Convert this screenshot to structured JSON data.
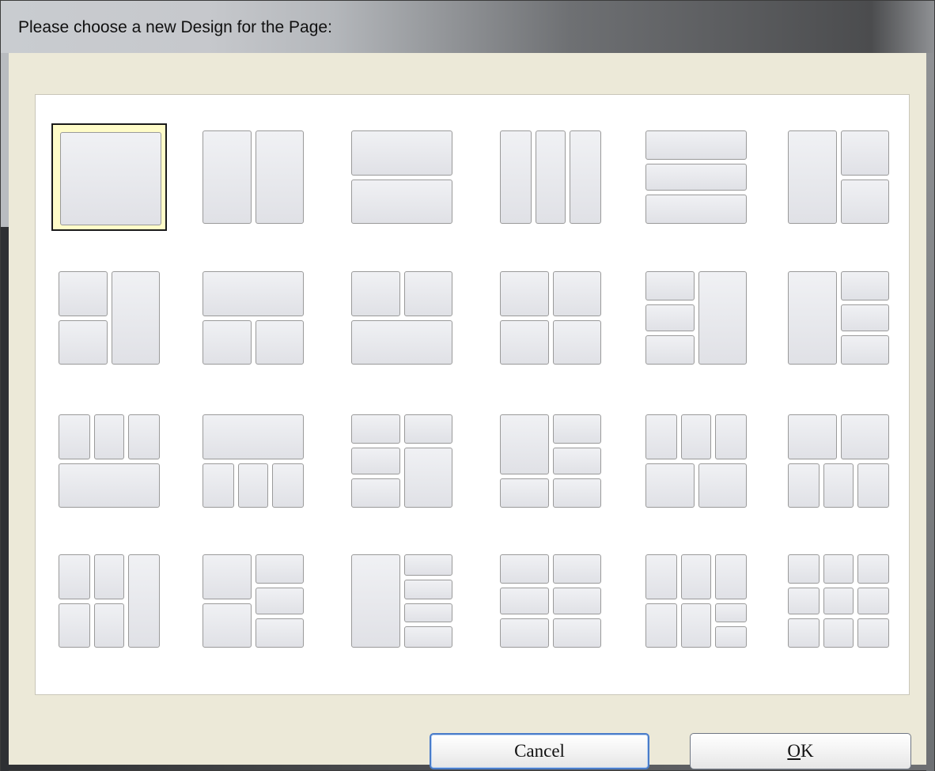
{
  "window": {
    "title": "Please choose a new Design for the Page:"
  },
  "buttons": {
    "cancel_label": "Cancel",
    "ok_mnemonic": "O",
    "ok_rest": "K"
  },
  "layouts": [
    {
      "name": "layout-1-single",
      "selected": true,
      "cells": [
        [
          0,
          0,
          1,
          1
        ]
      ]
    },
    {
      "name": "layout-2-columns",
      "cells": [
        [
          0,
          0,
          0.5,
          1
        ],
        [
          0.5,
          0,
          1,
          1
        ]
      ]
    },
    {
      "name": "layout-2-rows",
      "cells": [
        [
          0,
          0,
          1,
          0.5
        ],
        [
          0,
          0.5,
          1,
          1
        ]
      ]
    },
    {
      "name": "layout-3-columns",
      "cells": [
        [
          0,
          0,
          0.333,
          1
        ],
        [
          0.333,
          0,
          0.667,
          1
        ],
        [
          0.667,
          0,
          1,
          1
        ]
      ]
    },
    {
      "name": "layout-3-rows",
      "cells": [
        [
          0,
          0,
          1,
          0.333
        ],
        [
          0,
          0.333,
          1,
          0.667
        ],
        [
          0,
          0.667,
          1,
          1
        ]
      ]
    },
    {
      "name": "layout-big-left-two-right",
      "cells": [
        [
          0,
          0,
          0.5,
          1
        ],
        [
          0.5,
          0,
          1,
          0.5
        ],
        [
          0.5,
          0.5,
          1,
          1
        ]
      ]
    },
    {
      "name": "layout-two-left-big-right",
      "cells": [
        [
          0,
          0,
          0.5,
          0.5
        ],
        [
          0,
          0.5,
          0.5,
          1
        ],
        [
          0.5,
          0,
          1,
          1
        ]
      ]
    },
    {
      "name": "layout-top-wide-two-bottom",
      "cells": [
        [
          0,
          0,
          1,
          0.5
        ],
        [
          0,
          0.5,
          0.5,
          1
        ],
        [
          0.5,
          0.5,
          1,
          1
        ]
      ]
    },
    {
      "name": "layout-two-top-wide-bottom",
      "cells": [
        [
          0,
          0,
          0.5,
          0.5
        ],
        [
          0.5,
          0,
          1,
          0.5
        ],
        [
          0,
          0.5,
          1,
          1
        ]
      ]
    },
    {
      "name": "layout-2x2-grid",
      "cells": [
        [
          0,
          0,
          0.5,
          0.5
        ],
        [
          0.5,
          0,
          1,
          0.5
        ],
        [
          0,
          0.5,
          0.5,
          1
        ],
        [
          0.5,
          0.5,
          1,
          1
        ]
      ]
    },
    {
      "name": "layout-three-left-big-right",
      "cells": [
        [
          0,
          0,
          0.5,
          0.333
        ],
        [
          0,
          0.333,
          0.5,
          0.667
        ],
        [
          0,
          0.667,
          0.5,
          1
        ],
        [
          0.5,
          0,
          1,
          1
        ]
      ]
    },
    {
      "name": "layout-big-left-three-right",
      "cells": [
        [
          0,
          0,
          0.5,
          1
        ],
        [
          0.5,
          0,
          1,
          0.333
        ],
        [
          0.5,
          0.333,
          1,
          0.667
        ],
        [
          0.5,
          0.667,
          1,
          1
        ]
      ]
    },
    {
      "name": "layout-three-top-wide-bottom",
      "cells": [
        [
          0,
          0,
          0.333,
          0.5
        ],
        [
          0.333,
          0,
          0.667,
          0.5
        ],
        [
          0.667,
          0,
          1,
          0.5
        ],
        [
          0,
          0.5,
          1,
          1
        ]
      ]
    },
    {
      "name": "layout-wide-top-three-bottom",
      "cells": [
        [
          0,
          0,
          1,
          0.5
        ],
        [
          0,
          0.5,
          0.333,
          1
        ],
        [
          0.333,
          0.5,
          0.667,
          1
        ],
        [
          0.667,
          0.5,
          1,
          1
        ]
      ]
    },
    {
      "name": "layout-three-left-top-right-big",
      "cells": [
        [
          0,
          0,
          0.5,
          0.333
        ],
        [
          0.5,
          0,
          1,
          0.333
        ],
        [
          0,
          0.333,
          0.5,
          0.667
        ],
        [
          0,
          0.667,
          0.5,
          1
        ],
        [
          0.5,
          0.333,
          1,
          1
        ]
      ]
    },
    {
      "name": "layout-big-topleft-mixed",
      "cells": [
        [
          0,
          0,
          0.5,
          0.667
        ],
        [
          0.5,
          0,
          1,
          0.333
        ],
        [
          0.5,
          0.333,
          1,
          0.667
        ],
        [
          0,
          0.667,
          0.5,
          1
        ],
        [
          0.5,
          0.667,
          1,
          1
        ]
      ]
    },
    {
      "name": "layout-three-top-two-bottom",
      "cells": [
        [
          0,
          0,
          0.333,
          0.5
        ],
        [
          0.333,
          0,
          0.667,
          0.5
        ],
        [
          0.667,
          0,
          1,
          0.5
        ],
        [
          0,
          0.5,
          0.5,
          1
        ],
        [
          0.5,
          0.5,
          1,
          1
        ]
      ]
    },
    {
      "name": "layout-two-top-three-bottom",
      "cells": [
        [
          0,
          0,
          0.5,
          0.5
        ],
        [
          0.5,
          0,
          1,
          0.5
        ],
        [
          0,
          0.5,
          0.333,
          1
        ],
        [
          0.333,
          0.5,
          0.667,
          1
        ],
        [
          0.667,
          0.5,
          1,
          1
        ]
      ]
    },
    {
      "name": "layout-2x2-left-tall-right",
      "cells": [
        [
          0,
          0,
          0.333,
          0.5
        ],
        [
          0.333,
          0,
          0.667,
          0.5
        ],
        [
          0,
          0.5,
          0.333,
          1
        ],
        [
          0.333,
          0.5,
          0.667,
          1
        ],
        [
          0.667,
          0,
          1,
          1
        ]
      ]
    },
    {
      "name": "layout-two-left-three-right",
      "cells": [
        [
          0,
          0,
          0.5,
          0.5
        ],
        [
          0,
          0.5,
          0.5,
          1
        ],
        [
          0.5,
          0,
          1,
          0.333
        ],
        [
          0.5,
          0.333,
          1,
          0.667
        ],
        [
          0.5,
          0.667,
          1,
          1
        ]
      ]
    },
    {
      "name": "layout-tall-left-four-right",
      "cells": [
        [
          0,
          0,
          0.5,
          1
        ],
        [
          0.5,
          0,
          1,
          0.25
        ],
        [
          0.5,
          0.25,
          1,
          0.5
        ],
        [
          0.5,
          0.5,
          1,
          0.75
        ],
        [
          0.5,
          0.75,
          1,
          1
        ]
      ]
    },
    {
      "name": "layout-2x3-grid",
      "cells": [
        [
          0,
          0,
          0.5,
          0.333
        ],
        [
          0.5,
          0,
          1,
          0.333
        ],
        [
          0,
          0.333,
          0.5,
          0.667
        ],
        [
          0.5,
          0.333,
          1,
          0.667
        ],
        [
          0,
          0.667,
          0.5,
          1
        ],
        [
          0.5,
          0.667,
          1,
          1
        ]
      ]
    },
    {
      "name": "layout-3x2-with-split",
      "cells": [
        [
          0,
          0,
          0.333,
          0.5
        ],
        [
          0.333,
          0,
          0.667,
          0.5
        ],
        [
          0.667,
          0,
          1,
          0.5
        ],
        [
          0,
          0.5,
          0.333,
          1
        ],
        [
          0.333,
          0.5,
          0.667,
          1
        ],
        [
          0.667,
          0.5,
          1,
          0.75
        ],
        [
          0.667,
          0.75,
          1,
          1
        ]
      ]
    },
    {
      "name": "layout-3x3-grid",
      "cells": [
        [
          0,
          0,
          0.333,
          0.333
        ],
        [
          0.333,
          0,
          0.667,
          0.333
        ],
        [
          0.667,
          0,
          1,
          0.333
        ],
        [
          0,
          0.333,
          0.333,
          0.667
        ],
        [
          0.333,
          0.333,
          0.667,
          0.667
        ],
        [
          0.667,
          0.333,
          1,
          0.667
        ],
        [
          0,
          0.667,
          0.333,
          1
        ],
        [
          0.333,
          0.667,
          0.667,
          1
        ],
        [
          0.667,
          0.667,
          1,
          1
        ]
      ]
    }
  ]
}
